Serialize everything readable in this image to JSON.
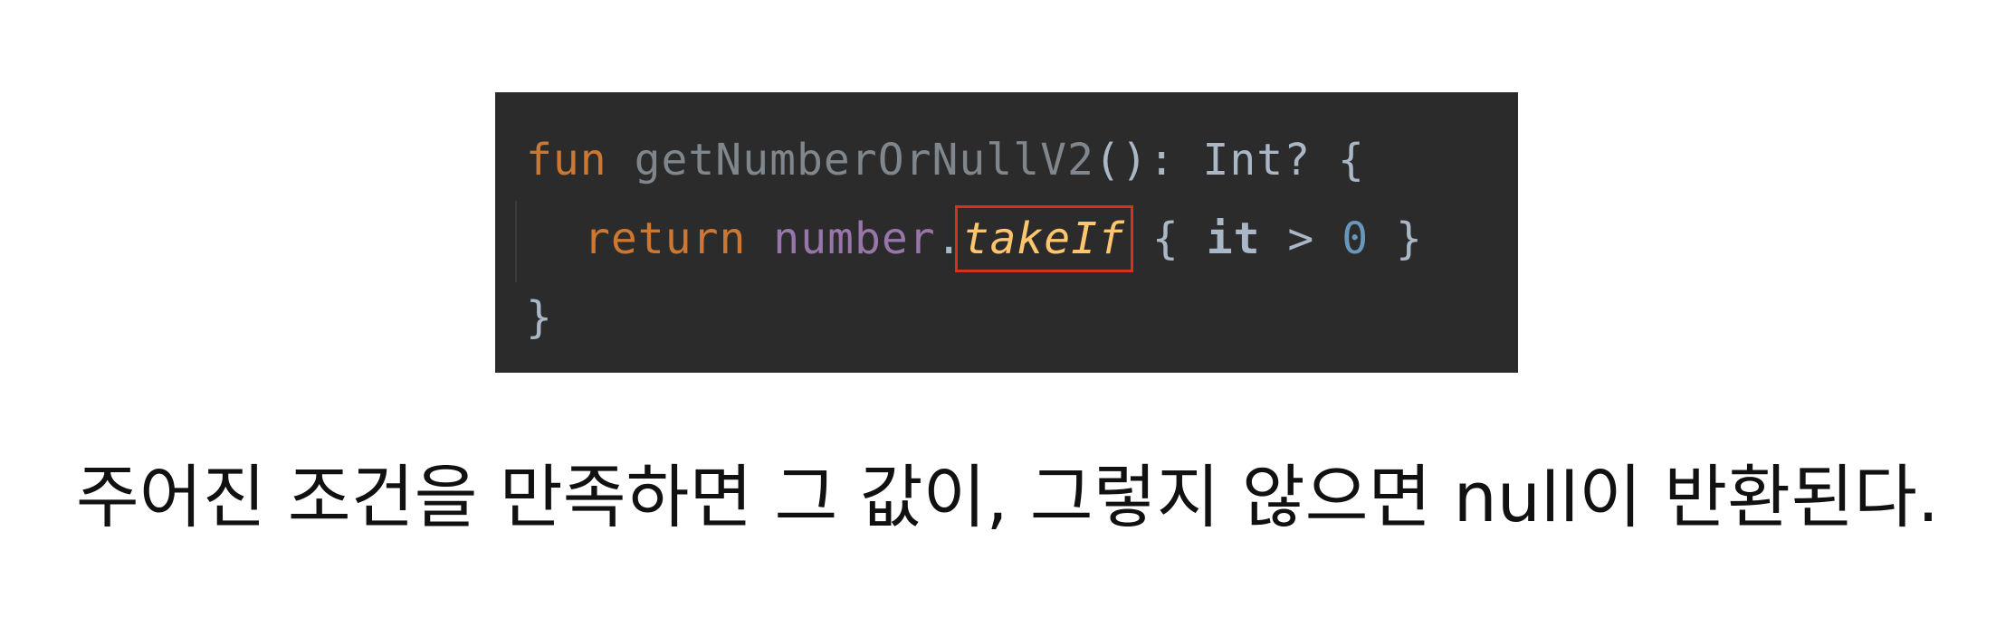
{
  "code": {
    "line1": {
      "kw_fun": "fun",
      "fn_name": "getNumberOrNullV2",
      "params": "():",
      "type": "Int?",
      "open_brace": "{"
    },
    "line2": {
      "kw_return": "return",
      "var_number": "number",
      "dot": ".",
      "ext_takeIf": "takeIf",
      "lambda_open": "{",
      "kw_it": "it",
      "op_gt": ">",
      "num_zero": "0",
      "lambda_close": "}"
    },
    "line3": {
      "close_brace": "}"
    },
    "highlight_color": "#d6301f"
  },
  "caption": {
    "text": "주어진 조건을 만족하면 그 값이, 그렇지 않으면 null이 반환된다."
  }
}
